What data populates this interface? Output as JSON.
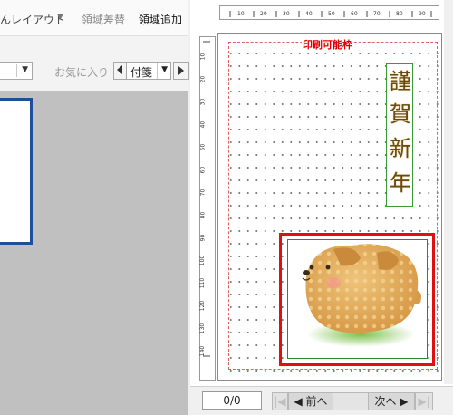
{
  "toolbar": {
    "layout_menu": "んレイアウト",
    "layout_arrow": "▼",
    "region_swap": "領域差替",
    "region_add": "領域追加",
    "favorites_label": "お気に入り",
    "category_value": "付箋",
    "dropdown_arrow": "▼"
  },
  "preview": {
    "print_frame_label": "印刷可能枠",
    "greeting_chars": [
      "謹",
      "賀",
      "新",
      "年"
    ],
    "ruler_h_ticks": [
      "10",
      "20",
      "30",
      "40",
      "50",
      "60",
      "70",
      "80",
      "90"
    ],
    "ruler_v_ticks": [
      "10",
      "20",
      "30",
      "40",
      "50",
      "60",
      "70",
      "80",
      "90",
      "100",
      "110",
      "120",
      "130",
      "140"
    ]
  },
  "nav": {
    "page_counter": "0/0",
    "first_glyph": "|◀",
    "prev_label": "◀ 前へ",
    "next_label": "次へ ▶",
    "last_glyph": "▶|"
  },
  "colors": {
    "print_frame": "#e00000",
    "selection_frame": "#e01010",
    "greeting_frame": "#3a9a3a",
    "thumb_border": "#1f4f9a"
  }
}
